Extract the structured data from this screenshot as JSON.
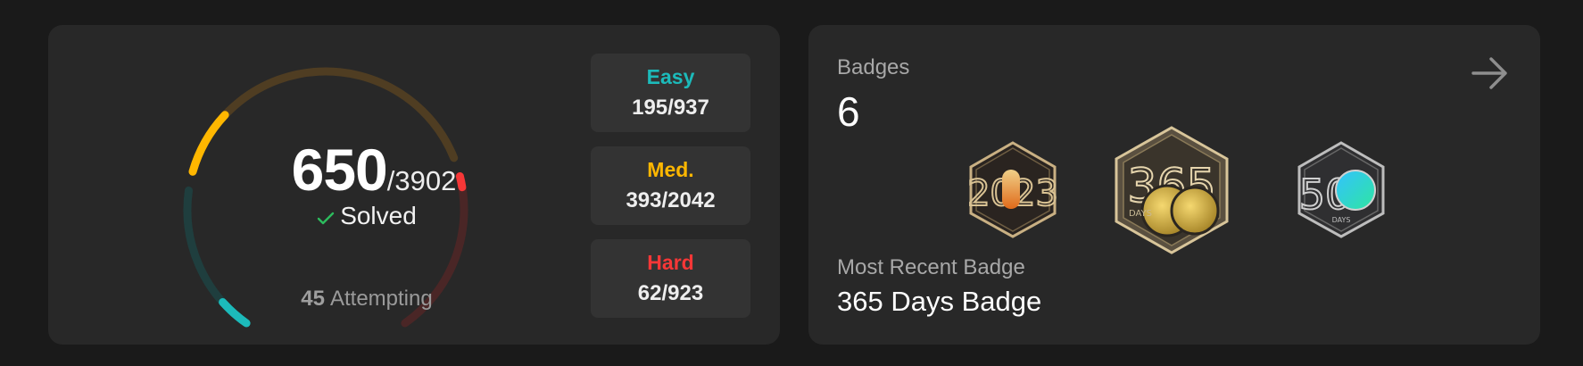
{
  "progress": {
    "solved": "650",
    "total": "/3902",
    "solved_label": "Solved",
    "attempting_count": "45",
    "attempting_label": "Attempting"
  },
  "difficulties": [
    {
      "label": "Easy",
      "value": "195/937",
      "color": "#1cbaba",
      "fraction": 0.208
    },
    {
      "label": "Med.",
      "value": "393/2042",
      "color": "#ffb700",
      "fraction": 0.192
    },
    {
      "label": "Hard",
      "value": "62/923",
      "color": "#f63737",
      "fraction": 0.067
    }
  ],
  "badges": {
    "title": "Badges",
    "count": "6",
    "items": [
      {
        "name": "2023-annual-badge",
        "text": "2023"
      },
      {
        "name": "365-days-badge",
        "text": "365",
        "sub": "DAYS"
      },
      {
        "name": "50-days-badge",
        "text": "50",
        "sub": "DAYS"
      }
    ],
    "recent_label": "Most Recent Badge",
    "recent_name": "365 Days Badge"
  },
  "colors": {
    "easy_track": "#1f3e3e",
    "medium_track": "#4f3d22",
    "hard_track": "#4a2626"
  }
}
